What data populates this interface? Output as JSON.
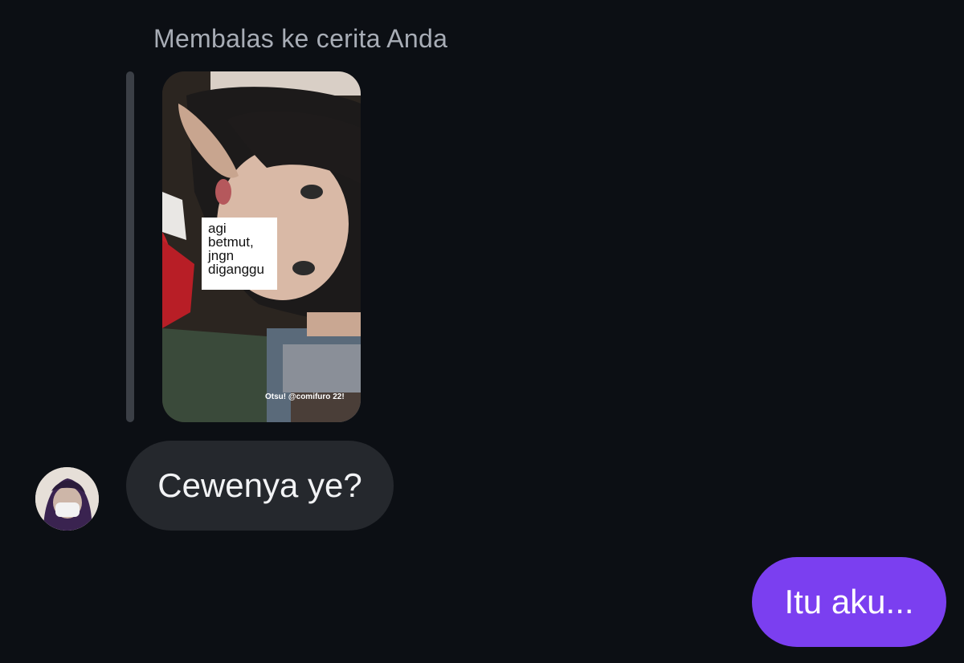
{
  "reply_context": {
    "header": "Membalas ke cerita Anda"
  },
  "story": {
    "caption": "agi\nbetmut,\njngn\ndiganggu",
    "credit": "Otsu! @comifuro 22!"
  },
  "messages": [
    {
      "sender": "other",
      "text": "Cewenya ye?"
    },
    {
      "sender": "me",
      "text": "Itu aku..."
    }
  ],
  "colors": {
    "background": "#0c0f14",
    "incoming_bubble": "#25282d",
    "outgoing_bubble": "#7b3ff0"
  },
  "icons": {
    "avatar": "user-avatar-photo"
  }
}
